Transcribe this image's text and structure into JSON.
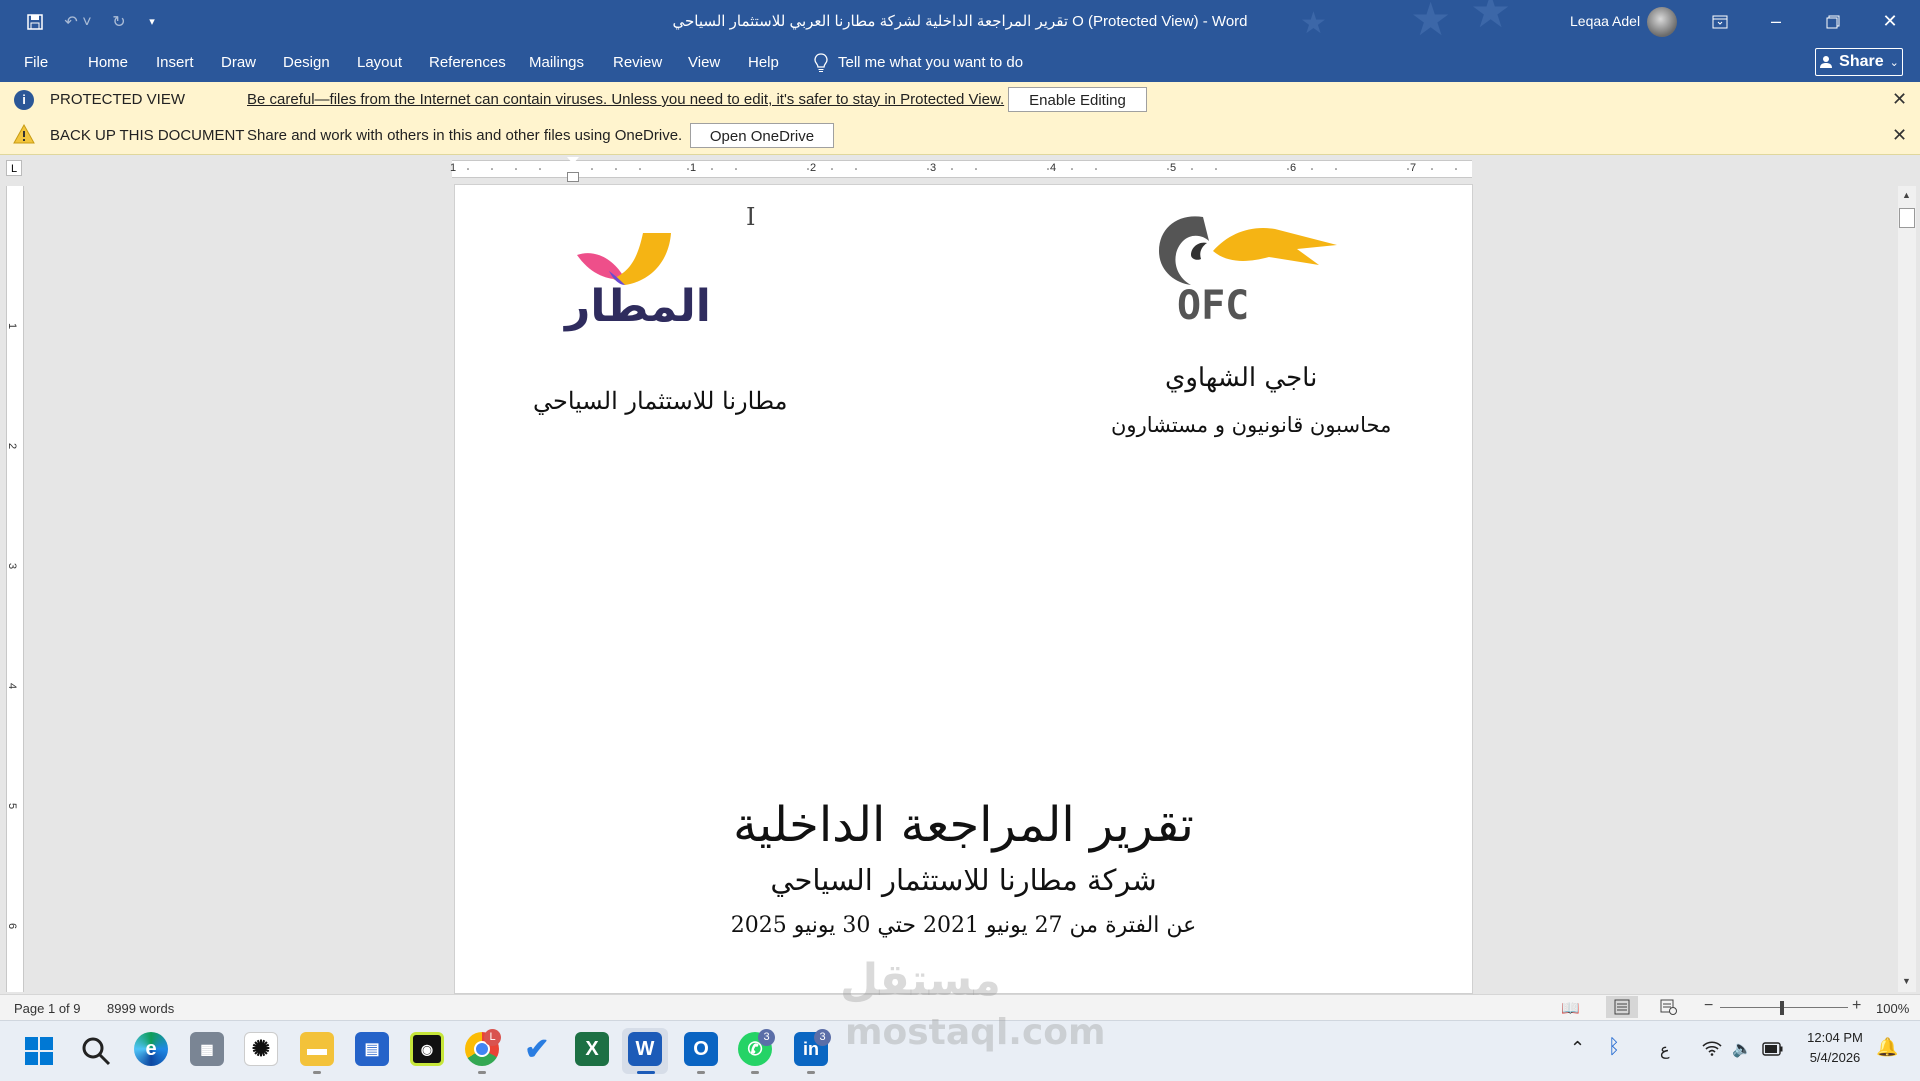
{
  "titlebar": {
    "title": "تقرير المراجعة الداخلية لشركة مطارنا العربي للاستثمار السياحي O (Protected View)  -  Word",
    "user_name": "Leqaa Adel",
    "icons": [
      "save-icon",
      "undo-icon",
      "redo-icon",
      "customize-icon",
      "ribbon-display-icon",
      "minimize-icon",
      "restore-icon",
      "close-icon"
    ]
  },
  "ribbon": {
    "tabs": [
      "File",
      "Home",
      "Insert",
      "Draw",
      "Design",
      "Layout",
      "References",
      "Mailings",
      "Review",
      "View",
      "Help"
    ],
    "tell_me": "Tell me what you want to do",
    "share_label": "Share"
  },
  "protected_bar": {
    "title": "PROTECTED VIEW",
    "message": "Be careful—files from the Internet can contain viruses. Unless you need to edit, it's safer to stay in Protected View.",
    "button": "Enable Editing"
  },
  "backup_bar": {
    "title": "BACK UP THIS DOCUMENT",
    "message": "Share and work with others in this and other files using OneDrive.",
    "button": "Open OneDrive"
  },
  "ruler": {
    "h_numbers": [
      "1",
      "1",
      "2",
      "3",
      "4",
      "5",
      "6",
      "7"
    ],
    "v_numbers": [
      "1",
      "2",
      "3",
      "4",
      "5",
      "6"
    ]
  },
  "document": {
    "page_marker": "I",
    "left_logo_text": "المطار",
    "left_company": "مطارنا للاستثمار السياحي",
    "right_logo_text": "OFC",
    "right_name": "ناجي الشهاوي",
    "right_subtitle": "محاسبون قانونيون و مستشارون",
    "main_title": "تقرير المراجعة الداخلية",
    "main_subtitle": "شركة مطارنا للاستثمار السياحي",
    "period": "عن الفترة من 27 يونيو 2021 حتي 30 يونيو 2025"
  },
  "statusbar": {
    "page": "Page 1 of 9",
    "words": "8999 words",
    "zoom": "100%"
  },
  "taskbar": {
    "badges": [
      "3",
      "3"
    ],
    "lang": "ع",
    "time": "12:04 PM",
    "date": "5/4/2026"
  },
  "watermark": {
    "arabic": "مستقل",
    "latin": "mostaql.com"
  },
  "colors": {
    "word_blue": "#2b579a",
    "message_bar": "#fff4ce",
    "logo_yellow": "#f5b414",
    "logo_pink": "#ee4f8a",
    "logo_navy": "#2f2c5e"
  }
}
